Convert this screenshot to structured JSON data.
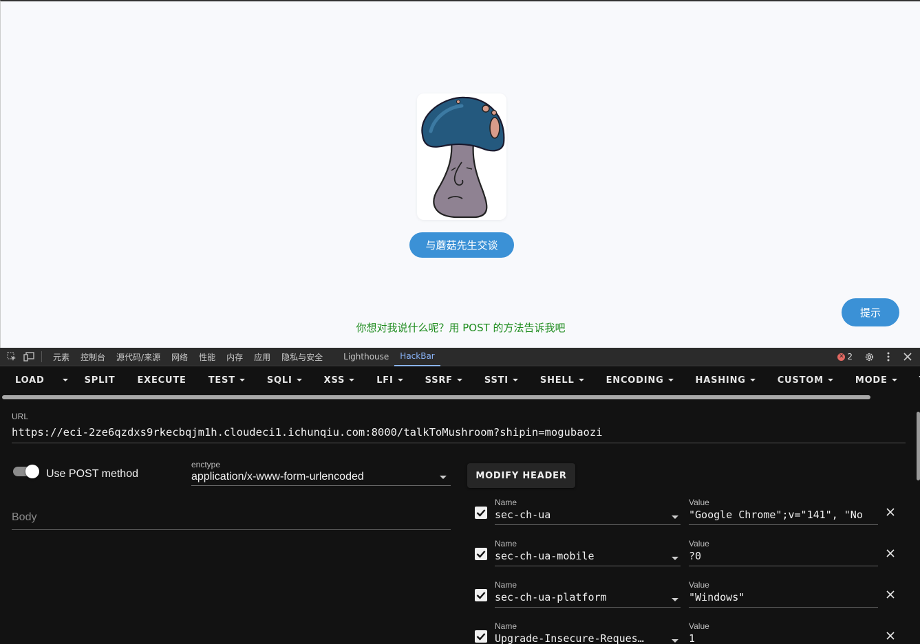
{
  "page": {
    "talk_button": "与蘑菇先生交谈",
    "hint_button": "提示",
    "message": "你想对我说什么呢？用 POST 的方法告诉我吧"
  },
  "devtools": {
    "tabs": [
      {
        "label": "元素"
      },
      {
        "label": "控制台"
      },
      {
        "label": "源代码/来源"
      },
      {
        "label": "网络"
      },
      {
        "label": "性能"
      },
      {
        "label": "内存"
      },
      {
        "label": "应用"
      },
      {
        "label": "隐私与安全"
      },
      {
        "label": "Lighthouse"
      },
      {
        "label": "HackBar"
      }
    ],
    "error_count": "2"
  },
  "hackbar": {
    "toolbar": {
      "load": "LOAD",
      "split": "SPLIT",
      "execute": "EXECUTE",
      "test": "TEST",
      "sqli": "SQLI",
      "xss": "XSS",
      "lfi": "LFI",
      "ssrf": "SSRF",
      "ssti": "SSTI",
      "shell": "SHELL",
      "encoding": "ENCODING",
      "hashing": "HASHING",
      "custom": "CUSTOM",
      "mode": "MODE",
      "theme": "TH"
    },
    "url_label": "URL",
    "url": "https://eci-2ze6qzdxs9rkecbqjm1h.cloudeci1.ichunqiu.com:8000/talkToMushroom?shipin=mogubaozi",
    "post_method_label": "Use POST method",
    "post_method_enabled": true,
    "enctype_label": "enctype",
    "enctype": "application/x-www-form-urlencoded",
    "body_placeholder": "Body",
    "modify_header_label": "MODIFY HEADER",
    "headers": [
      {
        "name_label": "Name",
        "name": "sec-ch-ua",
        "value_label": "Value",
        "value": "\"Google Chrome\";v=\"141\", \"No"
      },
      {
        "name_label": "Name",
        "name": "sec-ch-ua-mobile",
        "value_label": "Value",
        "value": "?0"
      },
      {
        "name_label": "Name",
        "name": "sec-ch-ua-platform",
        "value_label": "Value",
        "value": "\"Windows\""
      },
      {
        "name_label": "Name",
        "name": "Upgrade-Insecure-Reques…",
        "value_label": "Value",
        "value": "1"
      }
    ]
  },
  "colors": {
    "accent_blue": "#3b91d6",
    "message_green": "#1e8c1e",
    "devtools_active": "#8ab4f8",
    "hackbar_bg": "#121212"
  }
}
